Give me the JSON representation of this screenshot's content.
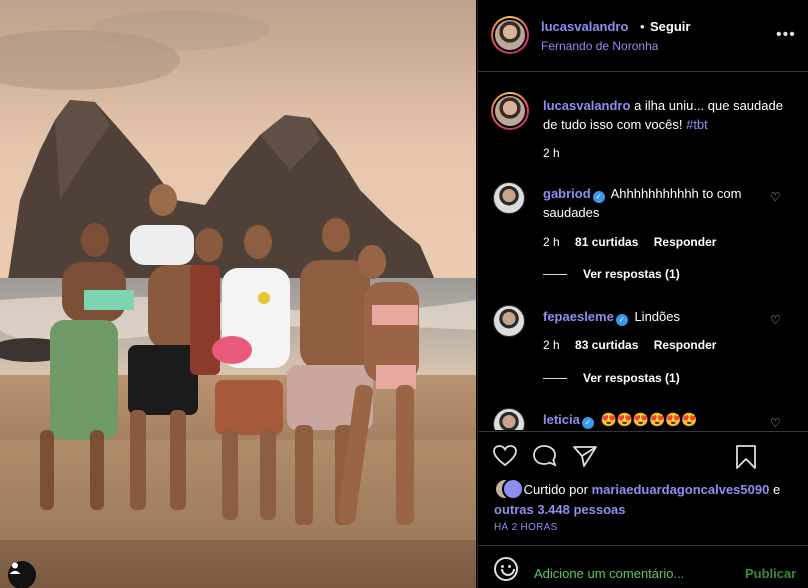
{
  "post": {
    "username": "lucasvalandro",
    "separator": "•",
    "follow_label": "Seguir",
    "location": "Fernando de Noronha",
    "more_icon": "more-options-icon"
  },
  "caption": {
    "username": "lucasvalandro",
    "text": "a ilha uniu... que saudade de tudo isso com vocês!",
    "hashtag": "#tbt",
    "time": "2 h"
  },
  "comments": [
    {
      "username": "gabriod",
      "verified": true,
      "text": "Ahhhhhhhhhhh to com saudades",
      "time": "2 h",
      "likes": "81 curtidas",
      "reply_label": "Responder",
      "view_replies": "Ver respostas (1)"
    },
    {
      "username": "fepaesleme",
      "verified": true,
      "text": "Lindões",
      "time": "2 h",
      "likes": "83 curtidas",
      "reply_label": "Responder",
      "view_replies": "Ver respostas (1)"
    },
    {
      "username": "leticia",
      "verified": true,
      "text": "😍😍😍😍😍😍"
    }
  ],
  "likes": {
    "prefix": "Curtido por",
    "user": "mariaeduardagoncalves5090",
    "connector": "e",
    "others": "outras 3.448 pessoas"
  },
  "time_ago": "HÁ 2 HORAS",
  "add_comment": {
    "placeholder": "Adicione um comentário...",
    "publish_label": "Publicar"
  },
  "colors": {
    "accent": "#8e8ef0",
    "verified": "#3897f0",
    "input_text": "#5ec95e"
  }
}
